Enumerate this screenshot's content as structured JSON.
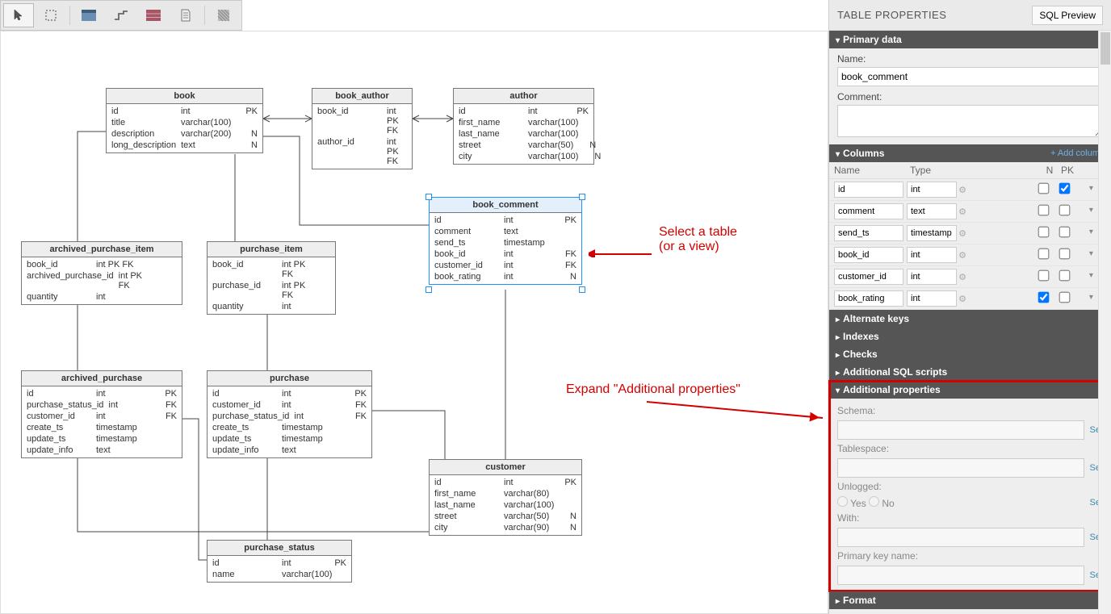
{
  "panel": {
    "title": "TABLE PROPERTIES",
    "sql_preview": "SQL Preview"
  },
  "primary": {
    "title": "Primary data",
    "name_label": "Name:",
    "name_value": "book_comment",
    "comment_label": "Comment:",
    "comment_value": ""
  },
  "columns_section": {
    "title": "Columns",
    "add_link": "+ Add column",
    "headers": {
      "name": "Name",
      "type": "Type",
      "n": "N",
      "pk": "PK"
    },
    "columns": [
      {
        "name": "id",
        "type": "int",
        "n": false,
        "pk": true
      },
      {
        "name": "comment",
        "type": "text",
        "n": false,
        "pk": false
      },
      {
        "name": "send_ts",
        "type": "timestamp",
        "n": false,
        "pk": false
      },
      {
        "name": "book_id",
        "type": "int",
        "n": false,
        "pk": false
      },
      {
        "name": "customer_id",
        "type": "int",
        "n": false,
        "pk": false
      },
      {
        "name": "book_rating",
        "type": "int",
        "n": true,
        "pk": false
      }
    ]
  },
  "accordion": {
    "alternate_keys": "Alternate keys",
    "indexes": "Indexes",
    "checks": "Checks",
    "additional_sql": "Additional SQL scripts",
    "additional_props": "Additional properties",
    "format": "Format"
  },
  "additional_properties": {
    "schema_label": "Schema:",
    "tablespace_label": "Tablespace:",
    "unlogged_label": "Unlogged:",
    "unlogged_yes": "Yes",
    "unlogged_no": "No",
    "with_label": "With:",
    "pk_name_label": "Primary key name:",
    "set": "Set"
  },
  "annotations": {
    "select_table": "Select a table",
    "or_view": "(or a view)",
    "expand_addl": "Expand \"Additional properties\""
  },
  "tables": {
    "book": {
      "title": "book",
      "cols": [
        [
          "id",
          "int",
          "PK"
        ],
        [
          "title",
          "varchar(100)",
          ""
        ],
        [
          "description",
          "varchar(200)",
          "N"
        ],
        [
          "long_description",
          "text",
          "N"
        ]
      ]
    },
    "book_author": {
      "title": "book_author",
      "cols": [
        [
          "book_id",
          "int PK FK",
          ""
        ],
        [
          "author_id",
          "int PK FK",
          ""
        ]
      ]
    },
    "author": {
      "title": "author",
      "cols": [
        [
          "id",
          "int",
          "PK"
        ],
        [
          "first_name",
          "varchar(100)",
          ""
        ],
        [
          "last_name",
          "varchar(100)",
          ""
        ],
        [
          "street",
          "varchar(50)",
          "N"
        ],
        [
          "city",
          "varchar(100)",
          "N"
        ]
      ]
    },
    "book_comment": {
      "title": "book_comment",
      "cols": [
        [
          "id",
          "int",
          "PK"
        ],
        [
          "comment",
          "text",
          ""
        ],
        [
          "send_ts",
          "timestamp",
          ""
        ],
        [
          "book_id",
          "int",
          "FK"
        ],
        [
          "customer_id",
          "int",
          "FK"
        ],
        [
          "book_rating",
          "int",
          "N"
        ]
      ]
    },
    "archived_purchase_item": {
      "title": "archived_purchase_item",
      "cols": [
        [
          "book_id",
          "int PK FK",
          ""
        ],
        [
          "archived_purchase_id",
          "int PK FK",
          ""
        ],
        [
          "quantity",
          "int",
          ""
        ]
      ]
    },
    "purchase_item": {
      "title": "purchase_item",
      "cols": [
        [
          "book_id",
          "int PK FK",
          ""
        ],
        [
          "purchase_id",
          "int PK FK",
          ""
        ],
        [
          "quantity",
          "int",
          ""
        ]
      ]
    },
    "archived_purchase": {
      "title": "archived_purchase",
      "cols": [
        [
          "id",
          "int",
          "PK"
        ],
        [
          "purchase_status_id",
          "int",
          "FK"
        ],
        [
          "customer_id",
          "int",
          "FK"
        ],
        [
          "create_ts",
          "timestamp",
          ""
        ],
        [
          "update_ts",
          "timestamp",
          ""
        ],
        [
          "update_info",
          "text",
          ""
        ]
      ]
    },
    "purchase": {
      "title": "purchase",
      "cols": [
        [
          "id",
          "int",
          "PK"
        ],
        [
          "customer_id",
          "int",
          "FK"
        ],
        [
          "purchase_status_id",
          "int",
          "FK"
        ],
        [
          "create_ts",
          "timestamp",
          ""
        ],
        [
          "update_ts",
          "timestamp",
          ""
        ],
        [
          "update_info",
          "text",
          ""
        ]
      ]
    },
    "customer": {
      "title": "customer",
      "cols": [
        [
          "id",
          "int",
          "PK"
        ],
        [
          "first_name",
          "varchar(80)",
          ""
        ],
        [
          "last_name",
          "varchar(100)",
          ""
        ],
        [
          "street",
          "varchar(50)",
          "N"
        ],
        [
          "city",
          "varchar(90)",
          "N"
        ]
      ]
    },
    "purchase_status": {
      "title": "purchase_status",
      "cols": [
        [
          "id",
          "int",
          "PK"
        ],
        [
          "name",
          "varchar(100)",
          ""
        ]
      ]
    }
  }
}
